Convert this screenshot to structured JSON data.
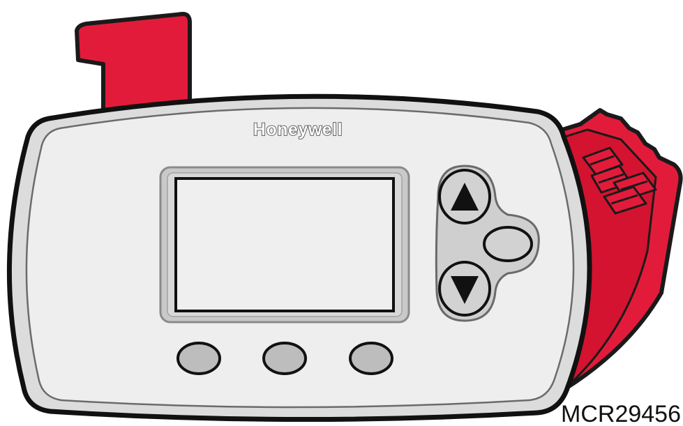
{
  "brand": {
    "name": "Honeywell"
  },
  "figure": {
    "code": "MCR29456"
  },
  "buttons": {
    "up_icon": "triangle-up",
    "down_icon": "triangle-down"
  },
  "colors": {
    "cover_red": "#e31b3b",
    "body_gray": "#e6e6e6",
    "button_gray": "#bdbdbd",
    "outline": "#1a1a1a"
  }
}
